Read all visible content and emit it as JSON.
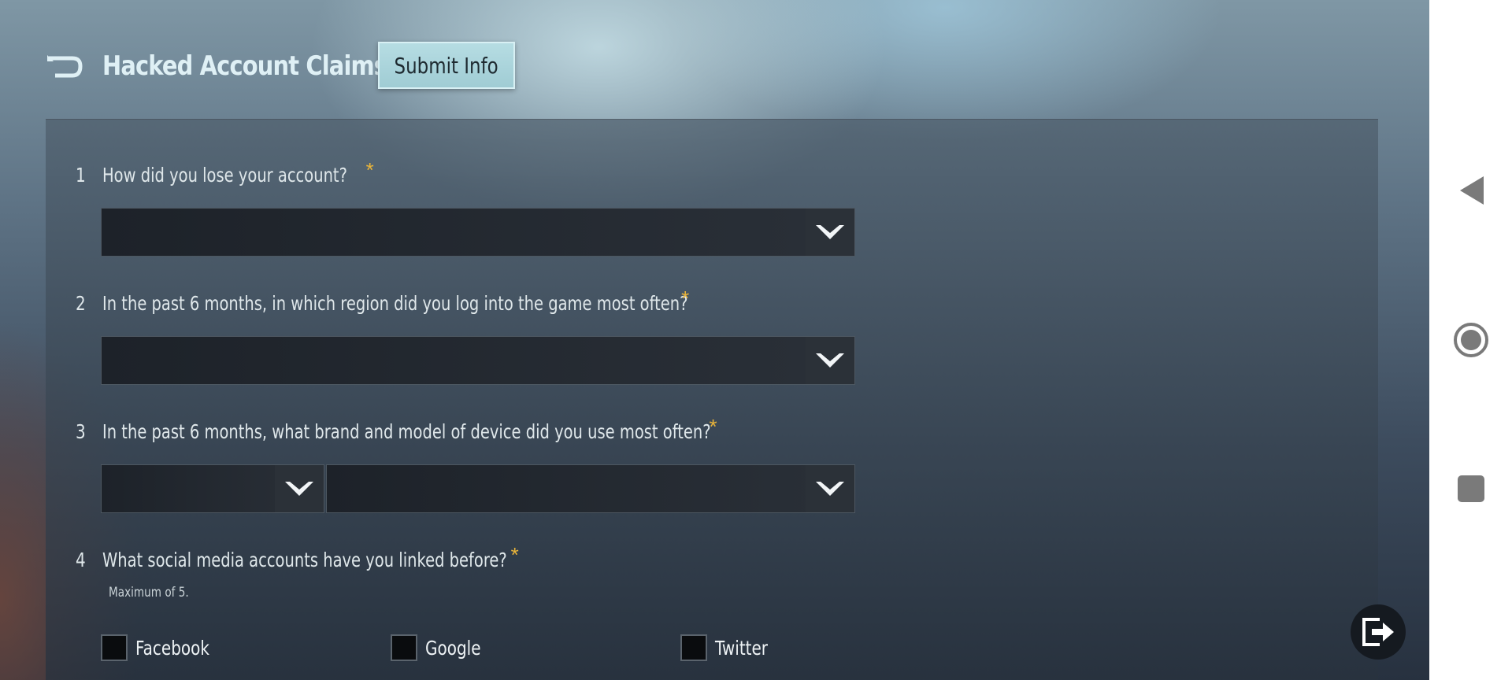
{
  "header": {
    "title": "Hacked Account Claims",
    "submit_label": "Submit Info"
  },
  "form": {
    "questions": [
      {
        "number": "1",
        "text": "How did you lose your account?",
        "required_mark": "*"
      },
      {
        "number": "2",
        "text": "In the past 6 months, in which region did you log into the game most often?",
        "required_mark": "*"
      },
      {
        "number": "3",
        "text": "In the past 6 months, what brand and model of device did you use most often?",
        "required_mark": "*"
      },
      {
        "number": "4",
        "text": "What social media accounts have you linked before?",
        "required_mark": "*",
        "hint": "Maximum of 5."
      }
    ],
    "social_options": [
      {
        "label": "Facebook",
        "checked": false
      },
      {
        "label": "Google",
        "checked": false
      },
      {
        "label": "Twitter",
        "checked": false
      }
    ]
  },
  "icons": {
    "back": "back-arrow-icon",
    "dropdown": "chevron-down-icon",
    "exit": "exit-icon",
    "nav_back": "triangle-back-icon",
    "nav_home": "circle-home-icon",
    "nav_recents": "square-recents-icon"
  },
  "colors": {
    "title": "#dff0f5",
    "required": "#e9b43a",
    "submit_button": "#a8d3da"
  }
}
